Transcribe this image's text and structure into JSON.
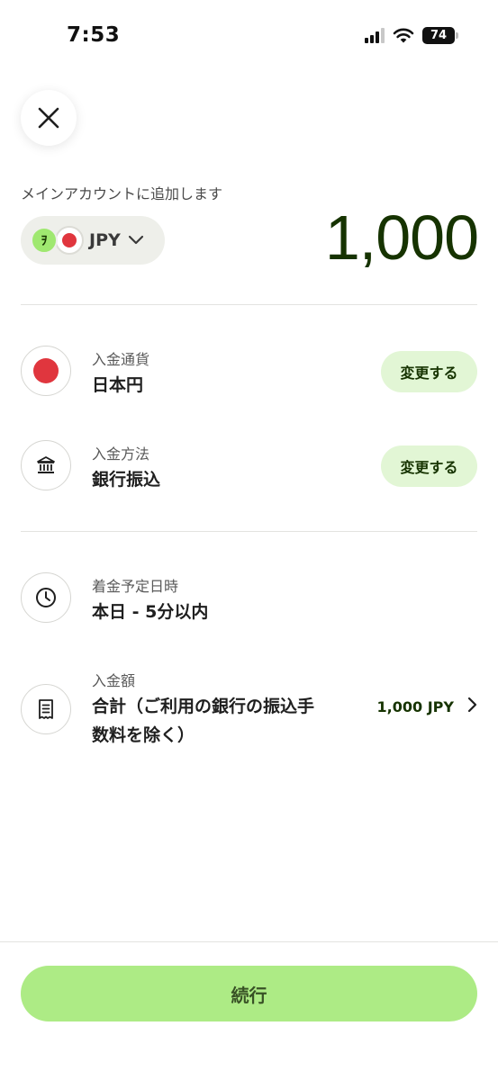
{
  "status_bar": {
    "time": "7:53",
    "battery": "74"
  },
  "header": {
    "add_to_label": "メインアカウントに追加します"
  },
  "currency_selector": {
    "brand_mark": "ｦ",
    "code": "JPY"
  },
  "amount": "1,000",
  "rows": {
    "deposit_currency": {
      "label": "入金通貨",
      "value": "日本円",
      "action": "変更する"
    },
    "deposit_method": {
      "label": "入金方法",
      "value": "銀行振込",
      "action": "変更する"
    },
    "arrival": {
      "label": "着金予定日時",
      "value": "本日 - 5分以内"
    },
    "deposit_amount": {
      "label": "入金額",
      "value_line1": "合計（ご利用の銀行の振込手",
      "value_line2": "数料を除く）",
      "amount": "1,000 JPY"
    }
  },
  "footer": {
    "continue_label": "続行"
  },
  "colors": {
    "accent": "#9fe870",
    "accent_soft": "#e2f6d5",
    "forest": "#163300",
    "flag_red": "#e0363e"
  },
  "icons": [
    "close-icon",
    "chevron-down-icon",
    "japan-flag-icon",
    "bank-icon",
    "clock-icon",
    "receipt-icon",
    "chevron-right-icon",
    "signal-icon",
    "wifi-icon",
    "battery-icon"
  ]
}
